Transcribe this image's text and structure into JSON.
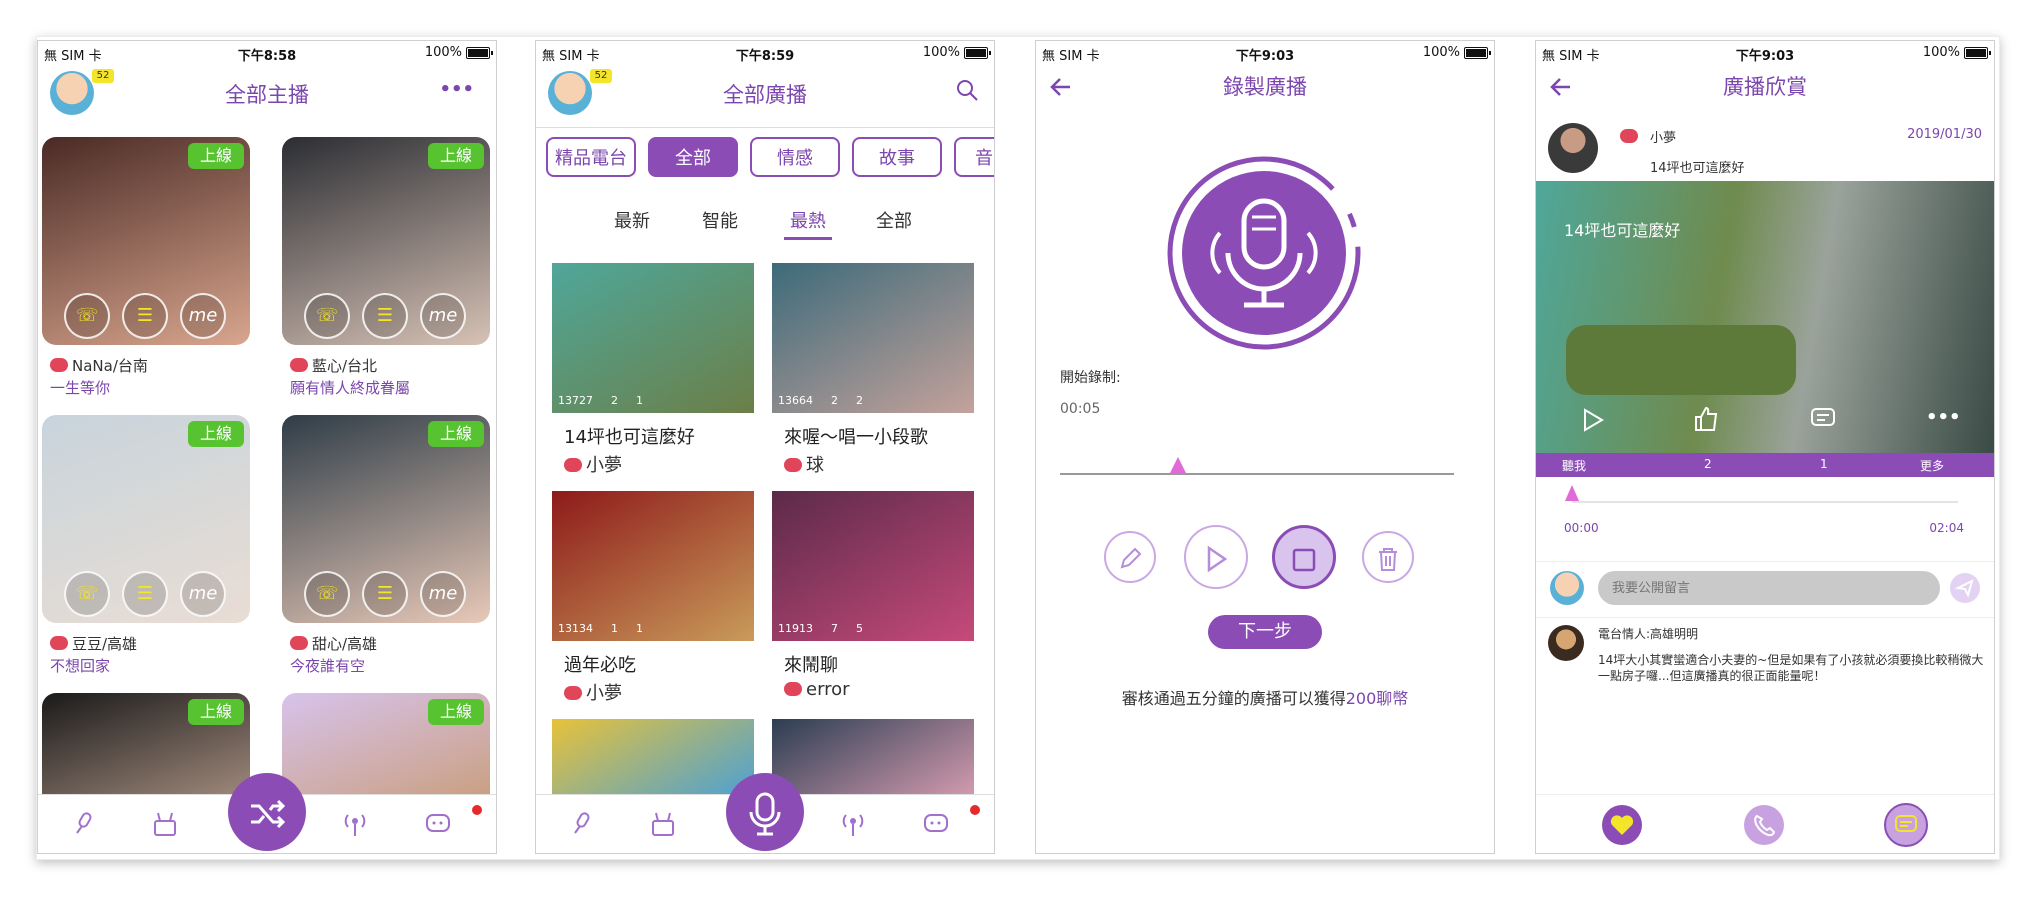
{
  "status_bars": [
    {
      "carrier": "無 SIM 卡",
      "time": "下午8:58",
      "battery": "100%"
    },
    {
      "carrier": "無 SIM 卡",
      "time": "下午8:59",
      "battery": "100%"
    },
    {
      "carrier": "無 SIM 卡",
      "time": "下午9:03",
      "battery": "100%"
    },
    {
      "carrier": "無 SIM 卡",
      "time": "下午9:03",
      "battery": "100%"
    }
  ],
  "screen1": {
    "title": "全部主播",
    "level_badge": "52",
    "more_glyph": "•••",
    "cards": [
      {
        "name": "NaNa/台南",
        "sub": "一生等你",
        "status": "上線",
        "colors": [
          "#4a2a25",
          "#d9a68e"
        ]
      },
      {
        "name": "藍心/台北",
        "sub": "願有情人終成眷屬",
        "status": "上線",
        "colors": [
          "#2b2d33",
          "#d7c2b5"
        ]
      },
      {
        "name": "豆豆/高雄",
        "sub": "不想回家",
        "status": "上線",
        "colors": [
          "#c8d4dc",
          "#e9ddd4"
        ]
      },
      {
        "name": "甜心/高雄",
        "sub": "今夜誰有空",
        "status": "上線",
        "colors": [
          "#2e3c47",
          "#e8c9b8"
        ]
      },
      {
        "status": "上線",
        "colors": [
          "#1a1a1a",
          "#b49a8a"
        ]
      },
      {
        "status": "上線",
        "colors": [
          "#d7c3ec",
          "#c89a72"
        ]
      }
    ],
    "card_icons": [
      "phone-icon",
      "chat-icon",
      "me-icon"
    ],
    "me_label": "me"
  },
  "screen2": {
    "title": "全部廣播",
    "level_badge": "52",
    "categories": [
      "精品電台",
      "全部",
      "情感",
      "故事",
      "音"
    ],
    "active_category": 1,
    "sort_tabs": [
      "最新",
      "智能",
      "最熱",
      "全部"
    ],
    "active_sort": 2,
    "tiles": [
      {
        "title": "14坪也可這麼好",
        "owner": "小夢",
        "listens": "13727",
        "likes": "2",
        "comments": "1",
        "colors": [
          "#4fa79a",
          "#6b7f48"
        ]
      },
      {
        "title": "來喔～唱一小段歌",
        "owner": "球",
        "listens": "13664",
        "likes": "2",
        "comments": "2",
        "colors": [
          "#3c6a7a",
          "#c4a29b"
        ]
      },
      {
        "title": "過年必吃",
        "owner": "小夢",
        "listens": "13134",
        "likes": "1",
        "comments": "1",
        "colors": [
          "#8e1a1a",
          "#c99b5a"
        ]
      },
      {
        "title": "來鬧聊",
        "owner": "error",
        "listens": "11913",
        "likes": "7",
        "comments": "5",
        "colors": [
          "#5b2a4a",
          "#c64a7a"
        ]
      },
      {
        "colors": [
          "#e7c23a",
          "#4aa0d6"
        ]
      },
      {
        "colors": [
          "#2b3d52",
          "#d69cb0"
        ]
      }
    ]
  },
  "screen3": {
    "title": "錄製廣播",
    "start_label": "開始錄制:",
    "elapsed": "00:05",
    "progress": 0.3,
    "next_button": "下一步",
    "notice_prefix": "審核通過五分鐘的廣播可以獲得",
    "notice_highlight": "200聊幣"
  },
  "screen4": {
    "title": "廣播欣賞",
    "author": "小夢",
    "post_title": "14坪也可這麼好",
    "date": "2019/01/30",
    "overlay_title": "14坪也可這麼好",
    "action_labels": [
      "聽我",
      "2",
      "1",
      "更多"
    ],
    "time_start": "00:00",
    "time_end": "02:04",
    "progress": 0.0,
    "comment_placeholder": "我要公開留言",
    "comment_author": "電台情人:高雄明明",
    "comment_text_1": "14坪大小其實蠻適合小夫妻的~但是如果有了小孩就必須要換比較稍微大",
    "comment_text_2": "一點房子囉...但這廣播真的很正面能量呢！"
  },
  "accent": "#8b4db5"
}
